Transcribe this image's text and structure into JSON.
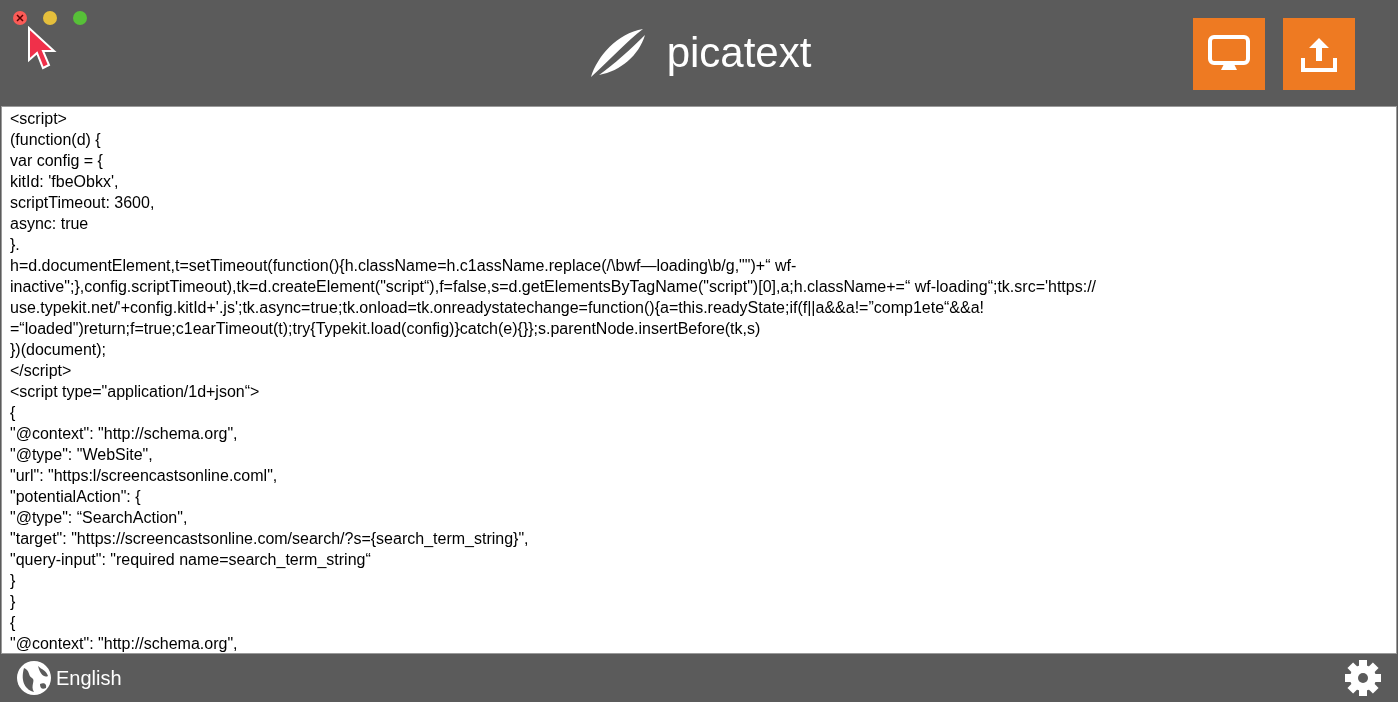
{
  "window": {
    "title": "picatext"
  },
  "toolbar": {
    "buttons": [
      {
        "kind": "display"
      },
      {
        "kind": "export"
      }
    ]
  },
  "editor": {
    "lines": [
      "<script>",
      "(function(d) {",
      "var config = {",
      "kitId: 'fbeObkx',",
      "scriptTimeout: 3600,",
      "async: true",
      "}.",
      "h=d.documentElement,t=setTimeout(function(){h.className=h.c1assName.replace(/\\bwf—loading\\b/g,\"\")+“ wf-",
      "inactive\";},config.scriptTimeout),tk=d.createElement(\"script“),f=false,s=d.getElementsByTagName(\"script\")[0],a;h.className+=“ wf-loading“;tk.src='https://",
      "use.typekit.net/'+config.kitId+'.js';tk.async=true;tk.onload=tk.onreadystatechange=function(){a=this.readyState;if(f||a&&a!=”comp1ete“&&a!",
      "=“loaded\")return;f=true;c1earTimeout(t);try{Typekit.load(config)}catch(e){}};s.parentNode.insertBefore(tk,s)",
      "})(document);",
      "</script>",
      "<script type=\"application/1d+json“>",
      "{",
      "\"@context\": \"http://schema.org\",",
      "\"@type\": \"WebSite\",",
      "\"url\": \"https:l/screencastsonline.coml\",",
      "\"potentialAction\": {",
      "\"@type\": “SearchAction\",",
      "\"target\": \"https://screencastsonline.com/search/?s={search_term_string}\",",
      "\"query-input\": \"required name=search_term_string“",
      "}",
      "}",
      "{",
      "\"@context\": \"http://schema.org\","
    ]
  },
  "status_bar": {
    "language": "English"
  }
}
